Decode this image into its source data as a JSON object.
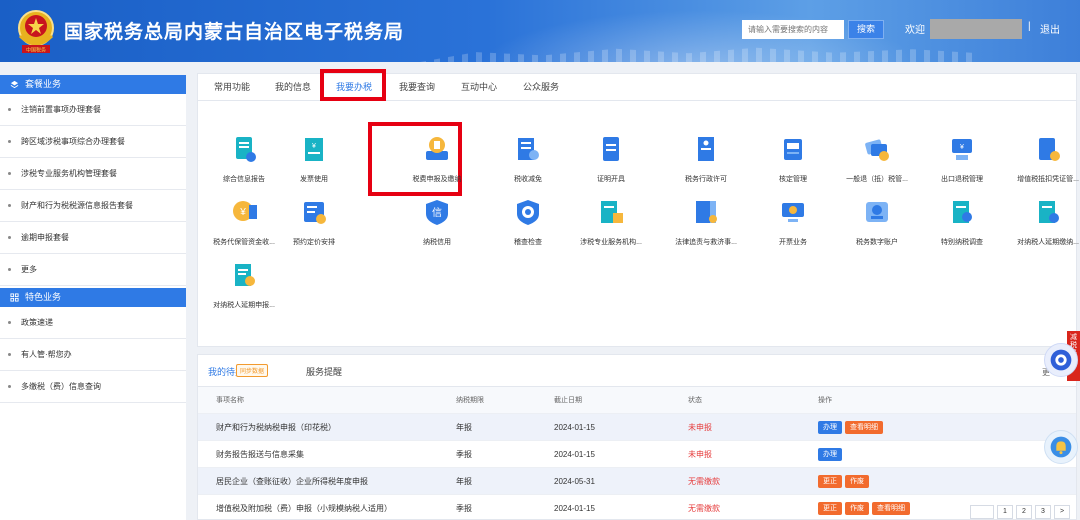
{
  "header": {
    "title": "国家税务总局内蒙古自治区电子税务局",
    "search_placeholder": "请输入需要搜索的内容",
    "search_label": "搜索",
    "welcome": "欢迎",
    "separator": "|",
    "logout": "退出",
    "emblem_text": "中国税务"
  },
  "sidebar": {
    "section1_title": "套餐业务",
    "section1_items": [
      "注销前置事项办理套餐",
      "跨区域涉税事项综合办理套餐",
      "涉税专业服务机构管理套餐",
      "财产和行为税税源信息报告套餐",
      "逾期申报套餐",
      "更多"
    ],
    "section2_title": "特色业务",
    "section2_items": [
      "政策速递",
      "有人管·帮您办",
      "多缴税（费）信息查询"
    ]
  },
  "tabs": [
    "常用功能",
    "我的信息",
    "我要办税",
    "我要查询",
    "互动中心",
    "公众服务"
  ],
  "services": [
    {
      "label": "综合信息报告",
      "icon": "doc-clip-icon"
    },
    {
      "label": "发票使用",
      "icon": "invoice-icon"
    },
    {
      "label": "税费申报及缴纳",
      "icon": "tax-declare-icon"
    },
    {
      "label": "税收减免",
      "icon": "tax-reduction-icon"
    },
    {
      "label": "证明开具",
      "icon": "certificate-icon"
    },
    {
      "label": "税务行政许可",
      "icon": "permit-icon"
    },
    {
      "label": "核定管理",
      "icon": "audit-icon"
    },
    {
      "label": "一般退（抵）税管...",
      "icon": "refund-cards-icon"
    },
    {
      "label": "出口退税管理",
      "icon": "export-refund-icon"
    },
    {
      "label": "增值税抵扣凭证管...",
      "icon": "vat-deduct-icon"
    },
    {
      "label": "税务代保管资金收...",
      "icon": "custody-fund-icon"
    },
    {
      "label": "预约定价安排",
      "icon": "pricing-icon"
    },
    {
      "label": "纳税信用",
      "icon": "credit-icon"
    },
    {
      "label": "稽查检查",
      "icon": "inspection-icon"
    },
    {
      "label": "涉税专业服务机构...",
      "icon": "agency-icon"
    },
    {
      "label": "法律追责与救济事...",
      "icon": "legal-book-icon"
    },
    {
      "label": "开票业务",
      "icon": "invoicing-icon"
    },
    {
      "label": "税务数字账户",
      "icon": "digital-account-icon"
    },
    {
      "label": "特别纳税调查",
      "icon": "special-investigation-icon"
    },
    {
      "label": "对纳税人延期缴纳...",
      "icon": "delay-pay-icon"
    },
    {
      "label": "对纳税人延期申报...",
      "icon": "delay-declare-icon"
    }
  ],
  "todo": {
    "tab_active": "我的待办",
    "sync_badge": "同步数据",
    "tab_other": "服务提醒",
    "more_label": "更",
    "columns": [
      "事项名称",
      "纳税期限",
      "截止日期",
      "状态",
      "操作"
    ],
    "rows": [
      {
        "name": "财产和行为税纳税申报（印花税）",
        "period": "年报",
        "deadline": "2024-01-15",
        "status": "未申报",
        "ops": [
          {
            "label": "办理",
            "color": "blue"
          },
          {
            "label": "查看明细",
            "color": "orange"
          }
        ]
      },
      {
        "name": "财务报告报送与信息采集",
        "period": "季报",
        "deadline": "2024-01-15",
        "status": "未申报",
        "ops": [
          {
            "label": "办理",
            "color": "blue"
          }
        ]
      },
      {
        "name": "居民企业（查账征收）企业所得税年度申报",
        "period": "年报",
        "deadline": "2024-05-31",
        "status": "无需缴款",
        "ops": [
          {
            "label": "更正",
            "color": "orange"
          },
          {
            "label": "作废",
            "color": "orange"
          }
        ]
      },
      {
        "name": "增值税及附加税（费）申报（小规模纳税人适用）",
        "period": "季报",
        "deadline": "2024-01-15",
        "status": "无需缴款",
        "ops": [
          {
            "label": "更正",
            "color": "orange"
          },
          {
            "label": "作废",
            "color": "orange"
          },
          {
            "label": "查看明细",
            "color": "orange"
          }
        ]
      }
    ],
    "pages": [
      "1",
      "2",
      "3",
      ">"
    ]
  },
  "float": {
    "red_tab": "减税降费"
  },
  "colors": {
    "primary": "#2f7ae5",
    "highlight": "#e60012",
    "danger": "#e63d3d",
    "orange": "#f26b2e"
  }
}
